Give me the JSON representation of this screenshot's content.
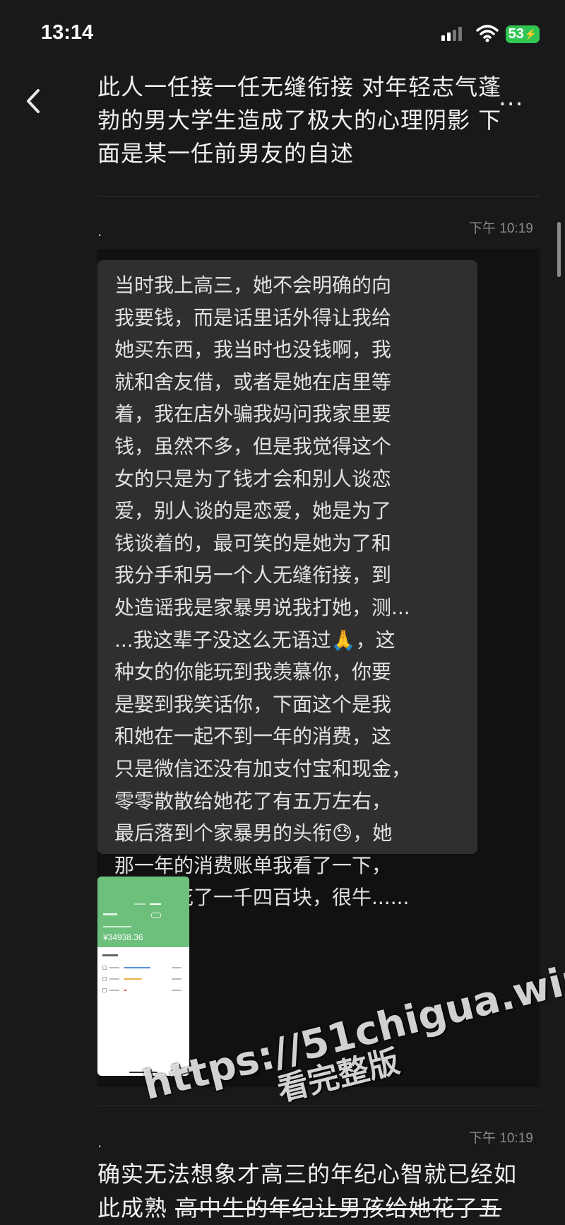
{
  "status_bar": {
    "time": "13:14",
    "battery": "53"
  },
  "header": {
    "title_lines": [
      "此人一任接一任无缝衔接 对年轻志气蓬",
      "勃的男大学生造成了极大的心理阴影  下",
      "面是某一任前男友的自述"
    ],
    "more": "..."
  },
  "reply_1": {
    "time": "下午 10:19",
    "dot": ".",
    "bubble_lines": [
      "当时我上高三，她不会明确的向",
      "我要钱，而是话里话外得让我给",
      "她买东西，我当时也没钱啊，我",
      "就和舍友借，或者是她在店里等",
      "着，我在店外骗我妈问我家里要",
      "钱，虽然不多，但是我觉得这个",
      "女的只是为了钱才会和别人谈恋",
      "爱，别人谈的是恋爱，她是为了",
      "钱谈着的，最可笑的是她为了和",
      "我分手和另一个人无缝衔接，到",
      "处造谣我是家暴男说我打她，测...",
      "...我这辈子没这么无语过🙏，这",
      "种女的你能玩到我羡慕你，你要",
      "是娶到我笑话你，下面这个是我",
      "和她在一起不到一年的消费，这",
      "只是微信还没有加支付宝和现金，",
      "零零散散给她花了有五万左右，",
      "最后落到个家暴男的头衔😓，她",
      "那一年的消费账单我看了一下，",
      "一整年花了一千四百块，很牛......"
    ],
    "screenshot": {
      "amount": "¥34938.36"
    }
  },
  "reply_2": {
    "time": "下午 10:19",
    "dot": ".",
    "line1": "确实无法想象才高三的年纪心智就已经如",
    "line2_plain": "此成熟 ",
    "line2_struck": "高中生的年纪让男孩给她花了五"
  },
  "watermark": {
    "url": "https://51chigua.win",
    "sub": "看完整版"
  }
}
